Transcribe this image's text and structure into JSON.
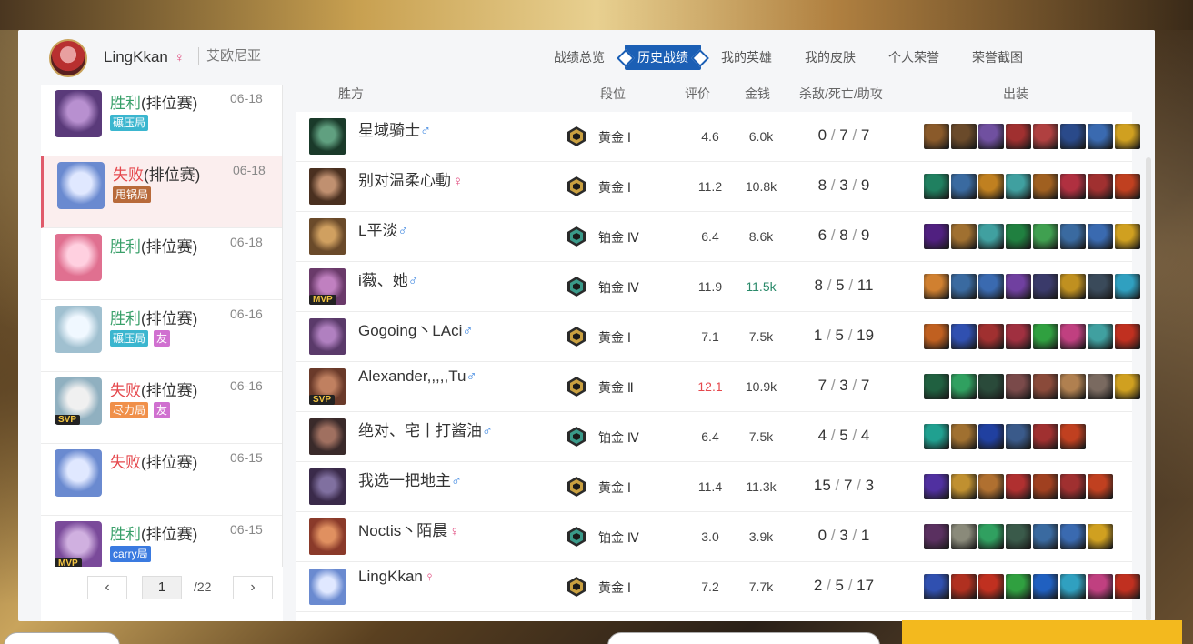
{
  "header": {
    "username": "LingKkan",
    "gender_symbol": "♀",
    "server": "艾欧尼亚"
  },
  "tabs": [
    {
      "label": "战绩总览"
    },
    {
      "label": "历史战绩",
      "active": true
    },
    {
      "label": "我的英雄"
    },
    {
      "label": "我的皮肤"
    },
    {
      "label": "个人荣誉"
    },
    {
      "label": "荣誉截图"
    }
  ],
  "matches": [
    {
      "result": "胜利",
      "mode": "(排位赛)",
      "date": "06-18",
      "tags": [
        {
          "text": "碾压局",
          "color": "#3bb6cf"
        }
      ],
      "colors": [
        "#5a3a7a",
        "#b890d0"
      ]
    },
    {
      "result": "失败",
      "mode": "(排位赛)",
      "date": "06-18",
      "tags": [
        {
          "text": "甩锅局",
          "color": "#b86a3a"
        }
      ],
      "colors": [
        "#6a8ad0",
        "#e0e8ff"
      ],
      "selected": true
    },
    {
      "result": "胜利",
      "mode": "(排位赛)",
      "date": "06-18",
      "tags": [],
      "colors": [
        "#e07090",
        "#ffd0e0"
      ]
    },
    {
      "result": "胜利",
      "mode": "(排位赛)",
      "date": "06-16",
      "tags": [
        {
          "text": "碾压局",
          "color": "#3bb6cf"
        },
        {
          "text": "友",
          "color": "#d070d0"
        }
      ],
      "colors": [
        "#a0c0d0",
        "#f0f8ff"
      ]
    },
    {
      "result": "失败",
      "mode": "(排位赛)",
      "date": "06-16",
      "tags": [
        {
          "text": "尽力局",
          "color": "#f0904a"
        },
        {
          "text": "友",
          "color": "#d070d0"
        }
      ],
      "colors": [
        "#90b0c0",
        "#f0f0f0"
      ],
      "badge": "SVP"
    },
    {
      "result": "失败",
      "mode": "(排位赛)",
      "date": "06-15",
      "tags": [],
      "colors": [
        "#6a8ad0",
        "#e0e8ff"
      ]
    },
    {
      "result": "胜利",
      "mode": "(排位赛)",
      "date": "06-15",
      "tags": [
        {
          "text": "carry局",
          "color": "#3a7ae0"
        }
      ],
      "colors": [
        "#7a4a9a",
        "#d0b0e0"
      ],
      "badge": "MVP"
    }
  ],
  "pager": {
    "prev": "‹",
    "current": "1",
    "total": "/22",
    "next": "›"
  },
  "table_headers": {
    "winner": "胜方",
    "rank": "段位",
    "score": "评价",
    "gold": "金钱",
    "kda": "杀敌/死亡/助攻",
    "items": "出装"
  },
  "players": [
    {
      "name": "星域骑士",
      "gender": "♂",
      "rank": "黄金 Ⅰ",
      "tier": "gold",
      "score": "4.6",
      "gold": "6.0k",
      "k": "0",
      "d": "7",
      "a": "7",
      "colors": [
        "#1a3a2a",
        "#60a080"
      ],
      "items": [
        "#8a5a2a",
        "#6a4a2a",
        "#7050a0",
        "#a03030",
        "#b04040",
        "#2a4a8a",
        "#3a6ab0",
        "#d0a020"
      ]
    },
    {
      "name": "别对温柔心動",
      "gender": "♀",
      "rank": "黄金 Ⅰ",
      "tier": "gold",
      "score": "11.2",
      "gold": "10.8k",
      "k": "8",
      "d": "3",
      "a": "9",
      "colors": [
        "#4a3020",
        "#c09070"
      ],
      "items": [
        "#208060",
        "#3a6aa0",
        "#c08020",
        "#40a0a0",
        "#a06020",
        "#b03040",
        "#a03030",
        "#c04020"
      ]
    },
    {
      "name": "L平淡",
      "gender": "♂",
      "rank": "铂金 Ⅳ",
      "tier": "plat",
      "score": "6.4",
      "gold": "8.6k",
      "k": "6",
      "d": "8",
      "a": "9",
      "colors": [
        "#6a4a2a",
        "#d0a060"
      ],
      "items": [
        "#502080",
        "#a07030",
        "#40a0a0",
        "#208040",
        "#40a050",
        "#3a6aa0",
        "#3a6ab0",
        "#d0a020"
      ]
    },
    {
      "name": "i薇、她",
      "gender": "♂",
      "rank": "铂金 Ⅳ",
      "tier": "plat",
      "score": "11.9",
      "gold": "11.5k",
      "gold_color": "#2a8a6a",
      "k": "8",
      "d": "5",
      "a": "11",
      "colors": [
        "#6a3a6a",
        "#c080c0"
      ],
      "badge": "MVP",
      "items": [
        "#d08030",
        "#3a6aa0",
        "#3a6ab0",
        "#7040a0",
        "#3a3a6a",
        "#c09020",
        "#3a4a5a",
        "#30a0c0"
      ]
    },
    {
      "name": "Gogoing丶LAci",
      "gender": "♂",
      "rank": "黄金 Ⅰ",
      "tier": "gold",
      "score": "7.1",
      "gold": "7.5k",
      "k": "1",
      "d": "5",
      "a": "19",
      "colors": [
        "#5a3a6a",
        "#b080c0"
      ],
      "items": [
        "#c06020",
        "#3050b0",
        "#a03030",
        "#a03040",
        "#30a040",
        "#c04080",
        "#40a0a0",
        "#c03020"
      ]
    },
    {
      "name": "Alexander,,,,,Tu",
      "gender": "♂",
      "rank": "黄金 Ⅱ",
      "tier": "gold",
      "score": "12.1",
      "score_color": "#e5484d",
      "gold": "10.9k",
      "k": "7",
      "d": "3",
      "a": "7",
      "colors": [
        "#6a3a2a",
        "#c08060"
      ],
      "badge": "SVP",
      "items": [
        "#206040",
        "#30a060",
        "#2a4a3a",
        "#7a4a4a",
        "#8a4a3a",
        "#b08050",
        "#7a6a60",
        "#d0a020"
      ]
    },
    {
      "name": "绝对、宅丨打酱油",
      "gender": "♂",
      "rank": "铂金 Ⅳ",
      "tier": "plat",
      "score": "6.4",
      "gold": "7.5k",
      "k": "4",
      "d": "5",
      "a": "4",
      "colors": [
        "#3a2a2a",
        "#a07060"
      ],
      "items": [
        "#20a090",
        "#a07030",
        "#2040a0",
        "#3a5a8a",
        "#a03030",
        "#c04020"
      ]
    },
    {
      "name": "我选一把地主",
      "gender": "♂",
      "rank": "黄金 Ⅰ",
      "tier": "gold",
      "score": "11.4",
      "gold": "11.3k",
      "k": "15",
      "d": "7",
      "a": "3",
      "colors": [
        "#3a2a4a",
        "#8070a0"
      ],
      "items": [
        "#5030a0",
        "#c09030",
        "#b07030",
        "#b03030",
        "#a04020",
        "#a03030",
        "#c04020"
      ]
    },
    {
      "name": "Noctis丶陌晨",
      "gender": "♀",
      "rank": "铂金 Ⅳ",
      "tier": "plat",
      "score": "3.0",
      "gold": "3.9k",
      "k": "0",
      "d": "3",
      "a": "1",
      "colors": [
        "#8a3a2a",
        "#e09060"
      ],
      "items": [
        "#5a3060",
        "#8a8a7a",
        "#30a060",
        "#3a5a4a",
        "#3a6aa0",
        "#3a6ab0",
        "#d0a020"
      ]
    },
    {
      "name": "LingKkan",
      "gender": "♀",
      "rank": "黄金 Ⅰ",
      "tier": "gold",
      "score": "7.2",
      "gold": "7.7k",
      "k": "2",
      "d": "5",
      "a": "17",
      "colors": [
        "#6a8ad0",
        "#e0e8ff"
      ],
      "items": [
        "#3050b0",
        "#b03020",
        "#c03020",
        "#30a040",
        "#2060c0",
        "#30a0c0",
        "#c04080",
        "#c03020"
      ]
    }
  ]
}
